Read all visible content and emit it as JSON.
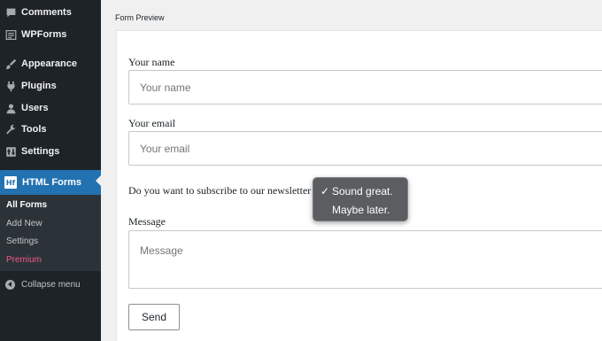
{
  "sidebar": {
    "items": [
      {
        "label": "Comments",
        "icon": "comments-icon"
      },
      {
        "label": "WPForms",
        "icon": "wpforms-icon"
      },
      {
        "label": "Appearance",
        "icon": "appearance-brush-icon"
      },
      {
        "label": "Plugins",
        "icon": "plugins-icon"
      },
      {
        "label": "Users",
        "icon": "users-icon"
      },
      {
        "label": "Tools",
        "icon": "tools-wrench-icon"
      },
      {
        "label": "Settings",
        "icon": "settings-icon"
      }
    ],
    "active": {
      "label": "HTML Forms",
      "logo": "Hf"
    },
    "submenu": [
      {
        "label": "All Forms"
      },
      {
        "label": "Add New"
      },
      {
        "label": "Settings"
      },
      {
        "label": "Premium"
      }
    ],
    "collapse_label": "Collapse menu"
  },
  "preview": {
    "title": "Form Preview",
    "name_label": "Your name",
    "name_placeholder": "Your name",
    "email_label": "Your email",
    "email_placeholder": "Your email",
    "newsletter_label": "Do you want to subscribe to our newsletter",
    "message_label": "Message",
    "message_placeholder": "Message",
    "send_label": "Send"
  },
  "newsletter_options": {
    "selected_mark": "✓",
    "options": [
      {
        "label": "Sound great.",
        "selected": true
      },
      {
        "label": "Maybe later.",
        "selected": false
      }
    ]
  },
  "colors": {
    "sidebar_bg": "#1d2327",
    "active_bg": "#2271b1",
    "premium": "#f2558a",
    "popup_bg": "#5b5d60"
  }
}
